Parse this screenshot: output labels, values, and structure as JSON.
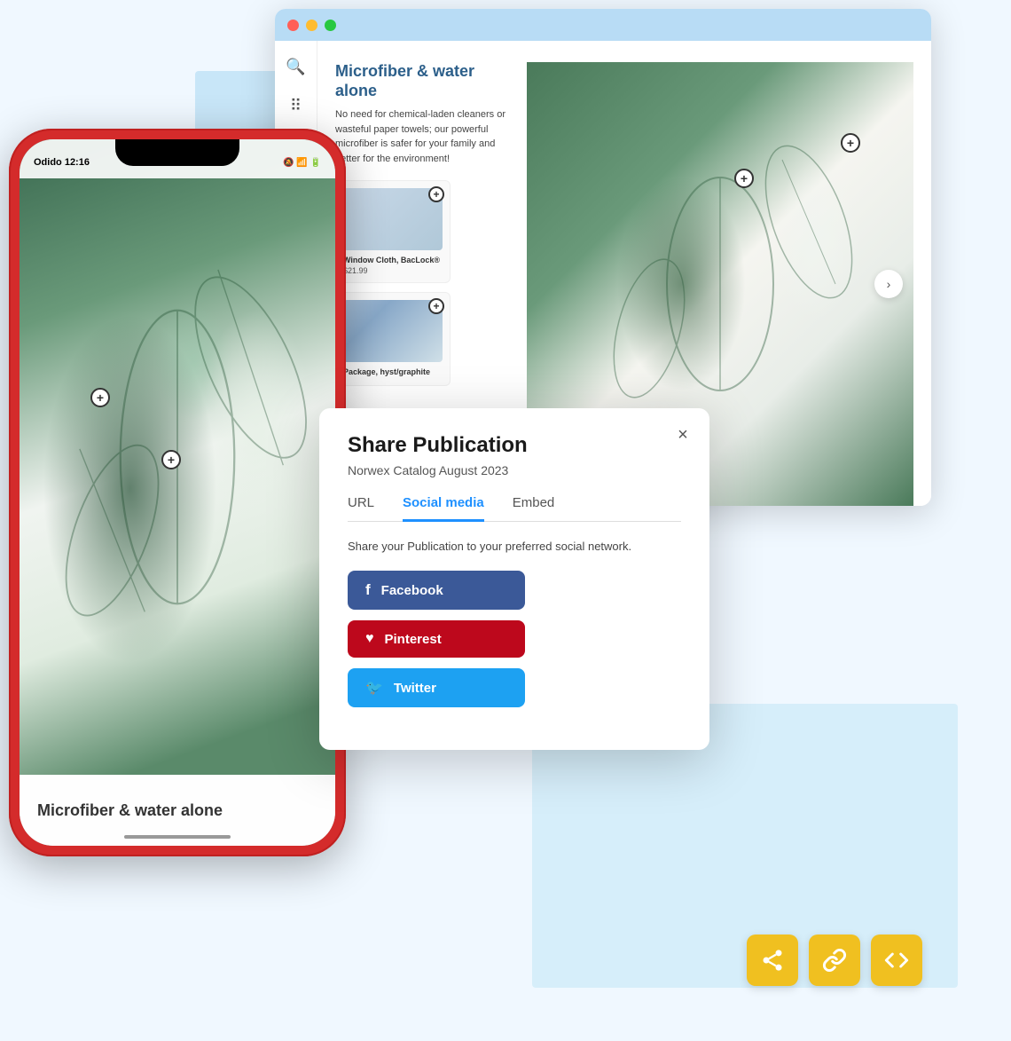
{
  "browser": {
    "dots": [
      "red",
      "yellow",
      "green"
    ],
    "product_title": "Microfiber & water alone",
    "product_desc": "No need for chemical-laden cleaners or wasteful paper towels; our powerful microfiber is safer for your family and better for the environment!",
    "product_cards": [
      {
        "name": "Window Cloth, BacLock®",
        "price": "$21.99"
      },
      {
        "name": "Package, hyst/graphite",
        "price": ""
      }
    ],
    "nav_arrow": "›"
  },
  "phone": {
    "status_carrier": "Odido",
    "status_time": "12:16",
    "bottom_title": "Microfiber & water alone"
  },
  "modal": {
    "title": "Share Publication",
    "subtitle": "Norwex Catalog August 2023",
    "close_label": "×",
    "tabs": [
      {
        "label": "URL",
        "active": false
      },
      {
        "label": "Social media",
        "active": true
      },
      {
        "label": "Embed",
        "active": false
      }
    ],
    "description": "Share your Publication to your preferred social network.",
    "buttons": [
      {
        "label": "Facebook",
        "class": "facebook",
        "icon": "f"
      },
      {
        "label": "Pinterest",
        "class": "pinterest",
        "icon": "♥"
      },
      {
        "label": "Twitter",
        "class": "twitter",
        "icon": "🐦"
      }
    ]
  },
  "bottom_icons": [
    {
      "name": "share-icon"
    },
    {
      "name": "link-icon"
    },
    {
      "name": "code-icon"
    }
  ]
}
